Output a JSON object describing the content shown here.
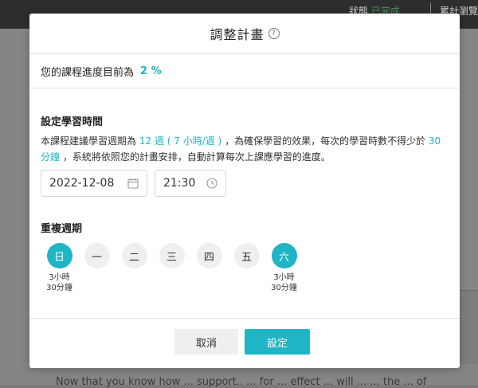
{
  "background": {
    "status_label": "狀態",
    "status_value": "已完成",
    "views_label": "累計瀏覽",
    "bottom_text": "Now that you know how ... support.. ... for ... effect ... will ... ... the ... of"
  },
  "modal": {
    "title": "調整計畫",
    "progress_label": "您的課程進度目前為",
    "progress_value": "2 %",
    "study_time": {
      "title": "設定學習時間",
      "desc_prefix": "本課程建議學習週期為",
      "weeks": "12 週 ( 7 小時/週 )",
      "desc_mid": "，為確保學習的效果，每次的學習時數不得少於",
      "min_time": "30 分鐘",
      "desc_suffix": "，系統將依照您的計畫安排，自動計算每次上課應學習的進度。",
      "date_value": "2022-12-08",
      "time_value": "21:30"
    },
    "repeat": {
      "title": "重複週期",
      "days": [
        {
          "label": "日",
          "active": true,
          "hours": "3小時",
          "minutes": "30分鐘"
        },
        {
          "label": "一",
          "active": false,
          "hours": "",
          "minutes": ""
        },
        {
          "label": "二",
          "active": false,
          "hours": "",
          "minutes": ""
        },
        {
          "label": "三",
          "active": false,
          "hours": "",
          "minutes": ""
        },
        {
          "label": "四",
          "active": false,
          "hours": "",
          "minutes": ""
        },
        {
          "label": "五",
          "active": false,
          "hours": "",
          "minutes": ""
        },
        {
          "label": "六",
          "active": true,
          "hours": "3小時",
          "minutes": "30分鐘"
        }
      ]
    },
    "buttons": {
      "cancel": "取消",
      "confirm": "設定"
    },
    "accent_color": "#1fb5c4"
  }
}
